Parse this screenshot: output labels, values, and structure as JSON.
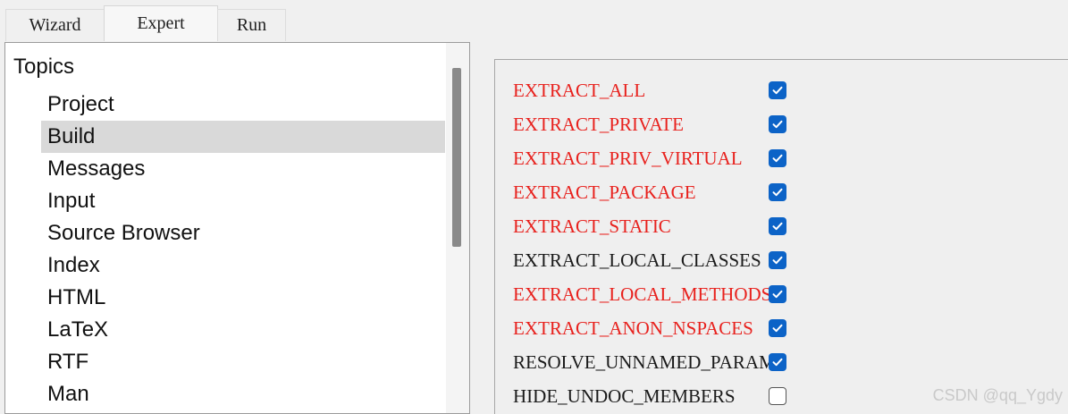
{
  "tabs": [
    {
      "label": "Wizard",
      "active": false
    },
    {
      "label": "Expert",
      "active": true
    },
    {
      "label": "Run",
      "active": false
    }
  ],
  "tree": {
    "root": "Topics",
    "items": [
      "Project",
      "Build",
      "Messages",
      "Input",
      "Source Browser",
      "Index",
      "HTML",
      "LaTeX",
      "RTF",
      "Man"
    ],
    "selected": "Build"
  },
  "options": [
    {
      "label": "EXTRACT_ALL",
      "checked": true,
      "changed": true
    },
    {
      "label": "EXTRACT_PRIVATE",
      "checked": true,
      "changed": true
    },
    {
      "label": "EXTRACT_PRIV_VIRTUAL",
      "checked": true,
      "changed": true
    },
    {
      "label": "EXTRACT_PACKAGE",
      "checked": true,
      "changed": true
    },
    {
      "label": "EXTRACT_STATIC",
      "checked": true,
      "changed": true
    },
    {
      "label": "EXTRACT_LOCAL_CLASSES",
      "checked": true,
      "changed": false
    },
    {
      "label": "EXTRACT_LOCAL_METHODS",
      "checked": true,
      "changed": true
    },
    {
      "label": "EXTRACT_ANON_NSPACES",
      "checked": true,
      "changed": true
    },
    {
      "label": "RESOLVE_UNNAMED_PARAMS",
      "checked": true,
      "changed": false
    },
    {
      "label": "HIDE_UNDOC_MEMBERS",
      "checked": false,
      "changed": false
    }
  ],
  "colors": {
    "changed_label": "#e8211d",
    "checkbox_on": "#0c63c7",
    "selection": "#d9d9d9"
  },
  "watermark": "CSDN @qq_Ygdy"
}
